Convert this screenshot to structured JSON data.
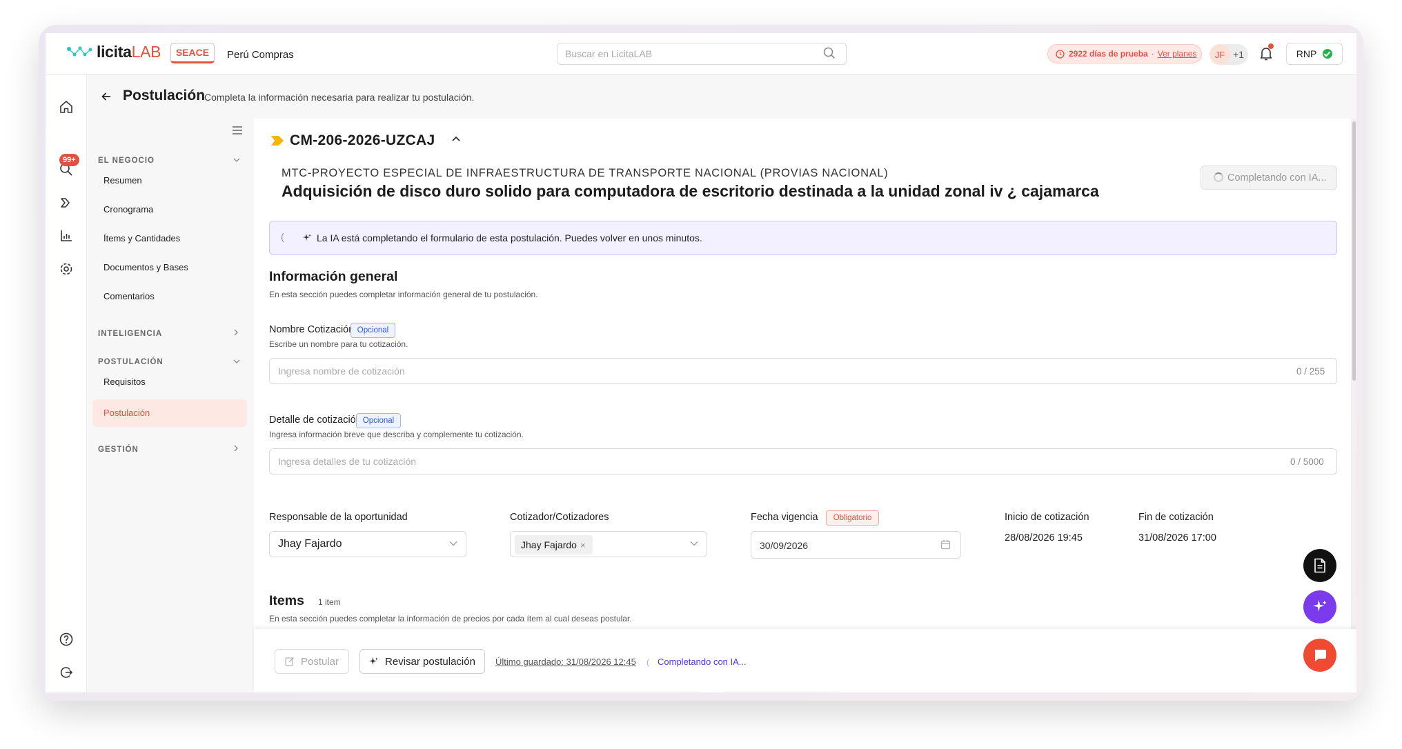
{
  "topbar": {
    "brand": "licita",
    "brand_suffix": "LAB",
    "seace": "SEACE",
    "peru_compras": "Perú Compras",
    "search_placeholder": "Buscar en LicitaLAB",
    "trial_days": "2922 días de prueba",
    "trial_sep": "·",
    "trial_link": "Ver planes",
    "avatar_initials": "JF",
    "avatar_more": "+1",
    "rnp": "RNP"
  },
  "rail": {
    "notifications_badge": "99+"
  },
  "header": {
    "title": "Postulación",
    "subtitle": "Completa la información necesaria para realizar tu postulación."
  },
  "sidebar": {
    "sections": [
      {
        "label": "EL NEGOCIO",
        "items": [
          "Resumen",
          "Cronograma",
          "Ítems y Cantidades",
          "Documentos y Bases",
          "Comentarios"
        ]
      },
      {
        "label": "INTELIGENCIA"
      },
      {
        "label": "POSTULACIÓN",
        "items": [
          "Requisitos",
          "Postulación"
        ]
      },
      {
        "label": "GESTIÓN"
      }
    ]
  },
  "tender": {
    "code": "CM-206-2026-UZCAJ",
    "entity": "MTC-PROYECTO ESPECIAL DE INFRAESTRUCTURA DE TRANSPORTE NACIONAL (PROVIAS NACIONAL)",
    "description": "Adquisición de disco duro solido para computadora de escritorio destinada a la unidad zonal iv ¿ cajamarca",
    "ai_button": "Completando con IA..."
  },
  "banner": {
    "paren": "(",
    "text": "La IA está completando el formulario de esta postulación. Puedes volver en unos minutos."
  },
  "info": {
    "title": "Información general",
    "desc": "En esta sección puedes completar información general de tu postulación.",
    "nombre": {
      "label": "Nombre Cotización",
      "badge": "Opcional",
      "help": "Escribe un nombre para tu cotización.",
      "placeholder": "Ingresa nombre de cotización",
      "counter": "0 / 255"
    },
    "detalle": {
      "label": "Detalle de cotización",
      "badge": "Opcional",
      "help": "Ingresa información breve que describa y complemente tu cotización.",
      "placeholder": "Ingresa detalles de tu cotización",
      "counter": "0 / 5000"
    },
    "responsable": {
      "label": "Responsable de la oportunidad",
      "value": "Jhay Fajardo"
    },
    "cotizador": {
      "label": "Cotizador/Cotizadores",
      "chip": "Jhay Fajardo",
      "chip_remove": "×"
    },
    "vigencia": {
      "label": "Fecha vigencia",
      "badge": "Obligatorio",
      "value": "30/09/2026"
    },
    "inicio": {
      "label": "Inicio de cotización",
      "value": "28/08/2026 19:45"
    },
    "fin": {
      "label": "Fin de cotización",
      "value": "31/08/2026 17:00"
    }
  },
  "items": {
    "title": "Items",
    "count": "1 item",
    "desc": "En esta sección puedes completar la información de precios por cada ítem al cual deseas postular."
  },
  "bottom": {
    "postular": "Postular",
    "revisar": "Revisar postulación",
    "saved": "Último guardado: 31/08/2026 12:45",
    "paren": "(",
    "status": "Completando con IA..."
  }
}
